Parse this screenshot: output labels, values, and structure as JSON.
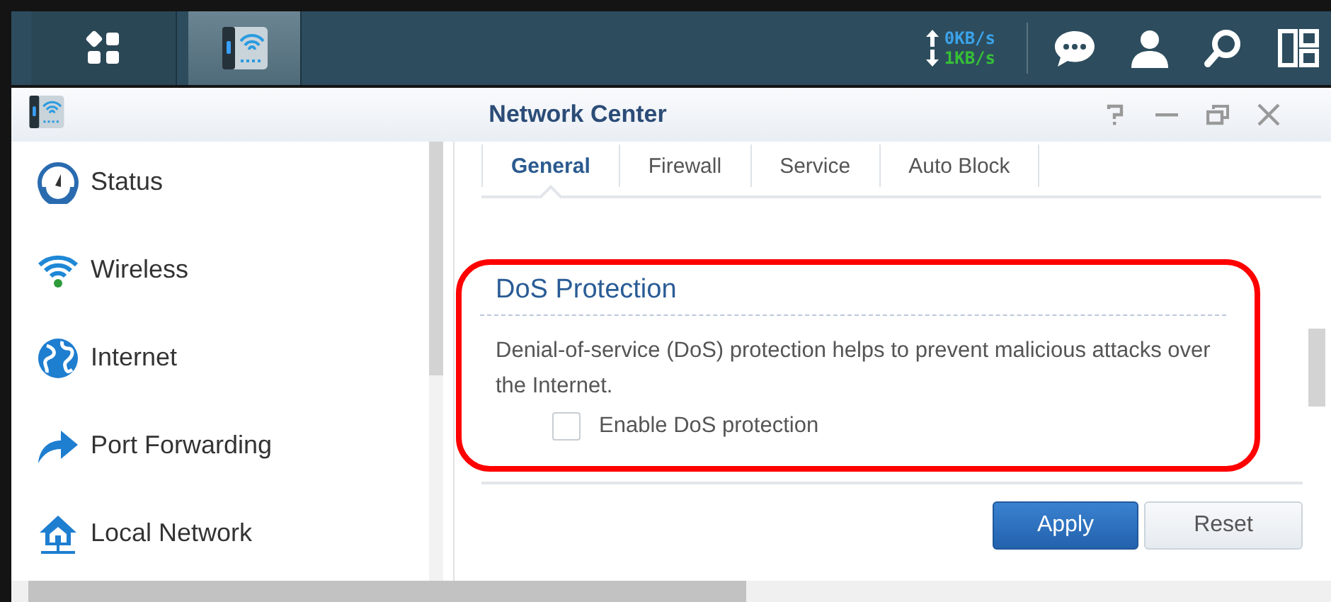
{
  "taskbar": {
    "items": [
      {
        "kind": "apps",
        "selected": false
      },
      {
        "kind": "network-app",
        "selected": true
      }
    ],
    "upload": "0KB/s",
    "download": "1KB/s",
    "tray": [
      {
        "kind": "chat"
      },
      {
        "kind": "user"
      },
      {
        "kind": "search"
      },
      {
        "kind": "widgets"
      }
    ]
  },
  "window": {
    "title": "Network Center",
    "controls": [
      {
        "kind": "help"
      },
      {
        "kind": "minimize"
      },
      {
        "kind": "restore"
      },
      {
        "kind": "close"
      }
    ]
  },
  "sidebar": {
    "items": [
      {
        "label": "Status",
        "kind": "status"
      },
      {
        "label": "Wireless",
        "kind": "wireless"
      },
      {
        "label": "Internet",
        "kind": "internet"
      },
      {
        "label": "Port Forwarding",
        "kind": "port-forwarding"
      },
      {
        "label": "Local Network",
        "kind": "local-network"
      }
    ]
  },
  "tabs": [
    {
      "label": "General",
      "selected": true
    },
    {
      "label": "Firewall",
      "selected": false
    },
    {
      "label": "Service",
      "selected": false
    },
    {
      "label": "Auto Block",
      "selected": false
    }
  ],
  "section": {
    "title": "DoS Protection",
    "highlighted": true,
    "description": "Denial-of-service (DoS) protection helps to prevent malicious attacks over the Internet.",
    "checkbox": {
      "label": "Enable DoS protection",
      "checked": false
    }
  },
  "buttons": [
    {
      "label": "Apply",
      "kind": "primary"
    },
    {
      "label": "Reset",
      "kind": "secondary"
    }
  ]
}
